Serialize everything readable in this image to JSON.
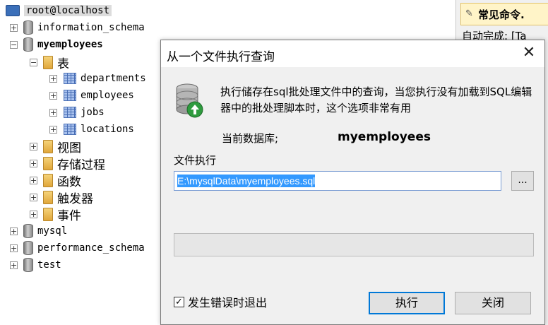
{
  "tree": {
    "root": "root@localhost",
    "databases": [
      {
        "name": "information_schema",
        "expanded": false
      },
      {
        "name": "myemployees",
        "expanded": true
      },
      {
        "name": "mysql",
        "expanded": false
      },
      {
        "name": "performance_schema",
        "expanded": false
      },
      {
        "name": "test",
        "expanded": false
      }
    ],
    "folder_tables": "表",
    "tables": [
      "departments",
      "employees",
      "jobs",
      "locations"
    ],
    "folders": [
      "视图",
      "存储过程",
      "函数",
      "触发器",
      "事件"
    ],
    "expander_plus": "+",
    "expander_minus": "−"
  },
  "side_panel": {
    "heading": "常见命令.",
    "line": "自动完成: [Ta"
  },
  "dialog": {
    "title": "从一个文件执行查询",
    "close_glyph": "✕",
    "description": "执行储存在sql批处理文件中的查询，当您执行没有加载到SQL编辑器中的批处理脚本时，这个选项非常有用",
    "current_db_label": "当前数据库;",
    "current_db_value": "myemployees",
    "file_label": "文件执行",
    "file_path": "E:\\mysqlData\\myemployees.sql",
    "browse_label": "...",
    "checkbox_label": "发生错误时退出",
    "checkbox_checked": true,
    "check_glyph": "✓",
    "run_button": "执行",
    "close_button": "关闭"
  },
  "colors": {
    "selection": "#3399ff",
    "default_button_border": "#0078d7",
    "root_highlight": "#dcdcdc"
  }
}
